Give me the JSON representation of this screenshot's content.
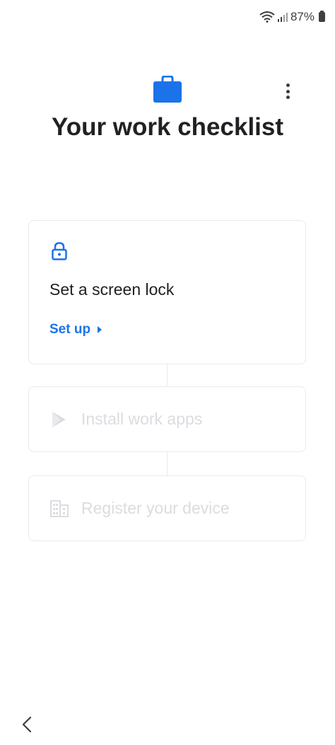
{
  "status_bar": {
    "battery_percent": "87%",
    "icons": [
      "wifi-icon",
      "signal-icon",
      "battery-icon"
    ]
  },
  "header": {
    "title": "Your work checklist",
    "icon": "briefcase-icon",
    "menu_icon": "more-vert-icon"
  },
  "steps": [
    {
      "title": "Set a screen lock",
      "action": "Set up",
      "icon": "lock-icon",
      "enabled": true
    },
    {
      "title": "Install work apps",
      "icon": "play-store-icon",
      "enabled": false
    },
    {
      "title": "Register your device",
      "icon": "building-icon",
      "enabled": false
    }
  ],
  "nav": {
    "back_icon": "chevron-left-icon"
  },
  "colors": {
    "accent": "#1a73e8",
    "text": "#202124",
    "disabled": "#dadce0",
    "border": "#e8eaed"
  }
}
